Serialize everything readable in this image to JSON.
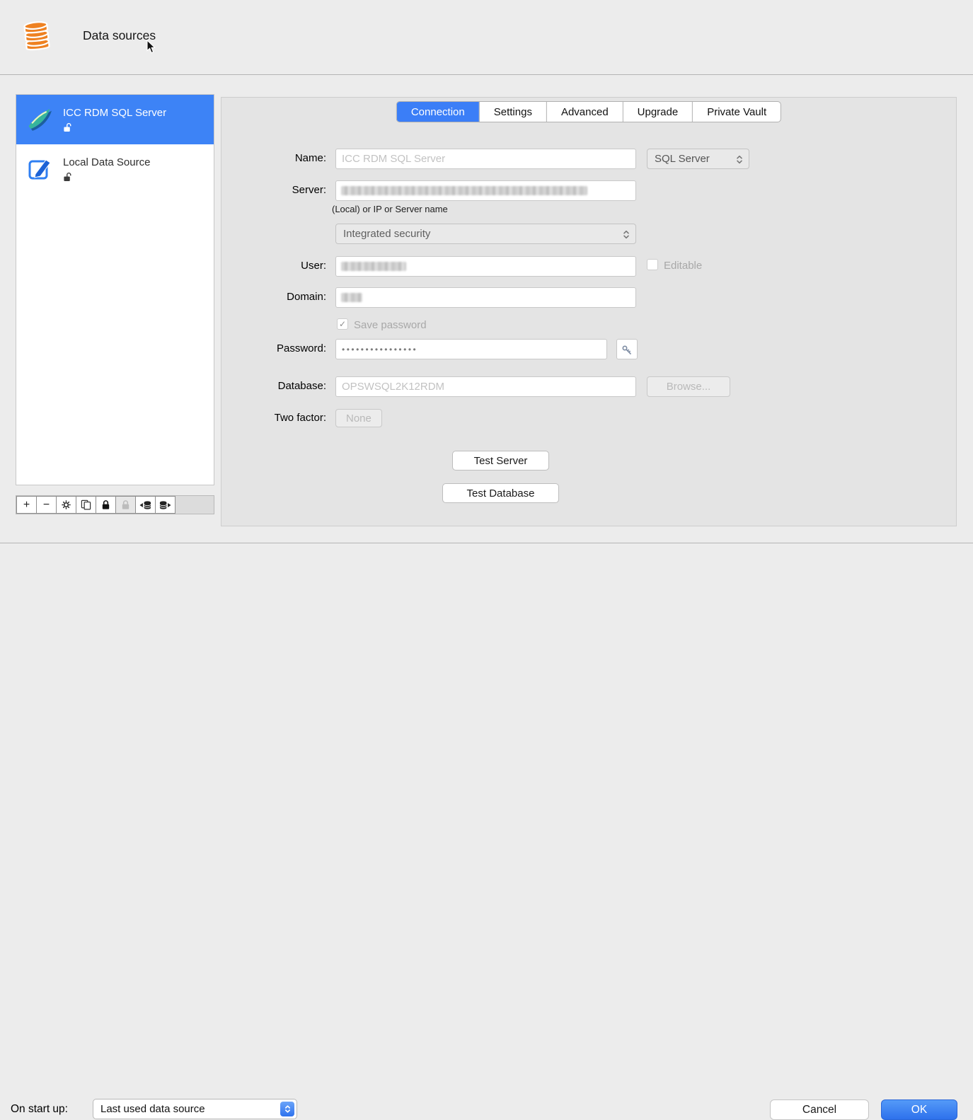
{
  "header": {
    "title": "Data sources"
  },
  "sidebar": {
    "items": [
      {
        "label": "ICC RDM SQL Server"
      },
      {
        "label": "Local Data Source"
      }
    ]
  },
  "toolbar": {
    "plus": "+",
    "minus": "−"
  },
  "tabs": [
    {
      "label": "Connection"
    },
    {
      "label": "Settings"
    },
    {
      "label": "Advanced"
    },
    {
      "label": "Upgrade"
    },
    {
      "label": "Private Vault"
    }
  ],
  "form": {
    "name_label": "Name:",
    "name_value": "ICC RDM SQL Server",
    "type_value": "SQL Server",
    "server_label": "Server:",
    "server_hint": "(Local) or IP or Server name",
    "security_value": "Integrated security",
    "user_label": "User:",
    "editable_label": "Editable",
    "domain_label": "Domain:",
    "save_password_label": "Save password",
    "checkmark": "✓",
    "password_label": "Password:",
    "password_value": "••••••••••••••••",
    "database_label": "Database:",
    "database_value": "OPSWSQL2K12RDM",
    "browse_label": "Browse...",
    "two_factor_label": "Two factor:",
    "two_factor_value": "None",
    "test_server_label": "Test Server",
    "test_database_label": "Test Database"
  },
  "footer": {
    "startup_label": "On start up:",
    "startup_value": "Last used data source",
    "cancel_label": "Cancel",
    "ok_label": "OK"
  },
  "colors": {
    "accent": "#3b7ef7",
    "selection": "#3d83f6"
  }
}
